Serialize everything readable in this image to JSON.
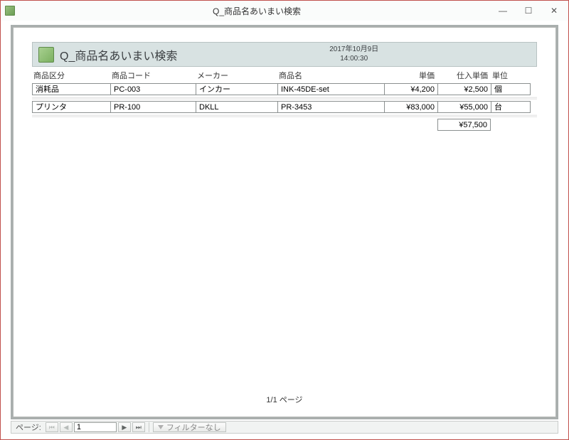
{
  "window": {
    "title": "Q_商品名あいまい検索"
  },
  "report": {
    "title": "Q_商品名あいまい検索",
    "date": "2017年10月9日",
    "time": "14:00:30",
    "columns": {
      "cat": "商品区分",
      "code": "商品コード",
      "maker": "メーカー",
      "name": "商品名",
      "price": "単価",
      "cost": "仕入単価",
      "unit": "単位"
    },
    "rows": [
      {
        "cat": "消耗品",
        "code": "PC-003",
        "maker": "インカー",
        "name": "INK-45DE-set",
        "price": "¥4,200",
        "cost": "¥2,500",
        "unit": "個"
      },
      {
        "cat": "プリンタ",
        "code": "PR-100",
        "maker": "DKLL",
        "name": "PR-3453",
        "price": "¥83,000",
        "cost": "¥55,000",
        "unit": "台"
      }
    ],
    "total": "¥57,500",
    "page_indicator": "1/1 ページ"
  },
  "nav": {
    "label": "ページ:",
    "current": "1",
    "filter_label": "フィルターなし"
  }
}
